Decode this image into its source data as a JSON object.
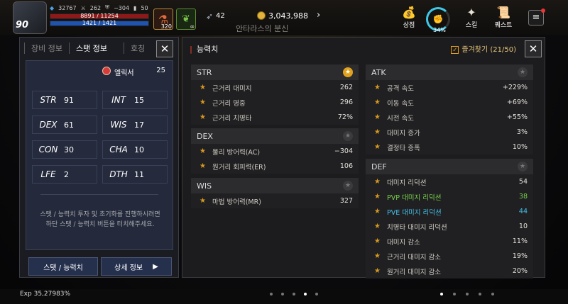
{
  "hud": {
    "level": "90",
    "power": "32767",
    "attack": "262",
    "defense": "−304",
    "misc_stat": "50",
    "hp": "8891 / 11254",
    "mp": "1421 / 1421",
    "potion_count": "320",
    "herb_count": "∞",
    "feather_count": "42",
    "gold": "3,043,988",
    "zone": "안타라스의 분신",
    "shop_label": "상점",
    "ring_pct": "34%",
    "skill_label": "스킬",
    "quest_label": "퀘스트"
  },
  "left_panel": {
    "tabs": [
      "장비 정보",
      "스탯 정보",
      "호칭"
    ],
    "elixir_label": "엘릭서",
    "elixir_value": "25",
    "stats": [
      {
        "k": "STR",
        "v": "91"
      },
      {
        "k": "INT",
        "v": "15"
      },
      {
        "k": "DEX",
        "v": "61"
      },
      {
        "k": "WIS",
        "v": "17"
      },
      {
        "k": "CON",
        "v": "30"
      },
      {
        "k": "CHA",
        "v": "10"
      },
      {
        "k": "LFE",
        "v": "2"
      },
      {
        "k": "DTH",
        "v": "11"
      }
    ],
    "description_1": "스탯 / 능력치 투자 및 초기화를 진행하시려면",
    "description_2": "하단 스탯 / 능력치 버튼을 터치해주세요.",
    "btn_stats": "스탯 / 능력치",
    "btn_detail": "상세 정보"
  },
  "right_panel": {
    "title": "능력치",
    "favorites": "즐겨찾기 (21/50)",
    "str": {
      "head": "STR",
      "rows": [
        [
          "근거리 대미지",
          "262"
        ],
        [
          "근거리 명중",
          "296"
        ],
        [
          "근거리 치명타",
          "72%"
        ]
      ]
    },
    "dex": {
      "head": "DEX",
      "rows": [
        [
          "물리 방어력(AC)",
          "−304"
        ],
        [
          "원거리 회피력(ER)",
          "106"
        ]
      ]
    },
    "wis": {
      "head": "WIS",
      "rows": [
        [
          "마법 방어력(MR)",
          "327"
        ]
      ]
    },
    "atk": {
      "head": "ATK",
      "rows": [
        [
          "공격 속도",
          "+229%"
        ],
        [
          "이동 속도",
          "+69%"
        ],
        [
          "시전 속도",
          "+55%"
        ],
        [
          "대미지 증가",
          "3%"
        ],
        [
          "결정타 증폭",
          "10%"
        ]
      ]
    },
    "def": {
      "head": "DEF",
      "rows": [
        [
          "대미지 리덕션",
          "54"
        ],
        [
          "PVP 대미지 리덕션",
          "38"
        ],
        [
          "PVE 대미지 리덕션",
          "44"
        ],
        [
          "치명타 대미지 리덕션",
          "10"
        ],
        [
          "대미지 감소",
          "11%"
        ],
        [
          "근거리 대미지 감소",
          "19%"
        ],
        [
          "원거리 대미지 감소",
          "20%"
        ]
      ]
    }
  },
  "bottom": {
    "exp": "Exp 35,27983%"
  }
}
